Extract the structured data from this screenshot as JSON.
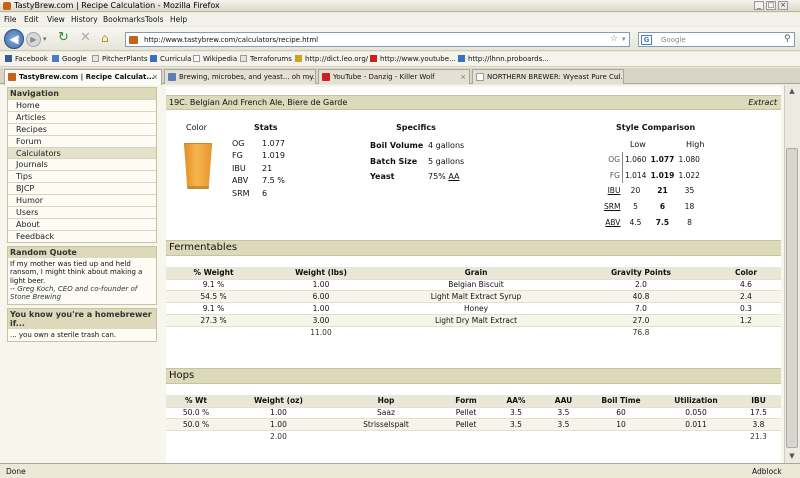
{
  "window": {
    "title": "TastyBrew.com | Recipe Calculation - Mozilla Firefox"
  },
  "menu": [
    "File",
    "Edit",
    "View",
    "History",
    "Bookmarks",
    "Tools",
    "Help"
  ],
  "nav": {
    "url": "http://www.tastybrew.com/calculators/recipe.html",
    "search_placeholder": "Google"
  },
  "bookmarks": [
    "Facebook",
    "Google",
    "PitcherPlants",
    "Curricula",
    "Wikipedia",
    "Terraforums",
    "http://dict.leo.org/",
    "http://www.youtube...",
    "http://lhnn.proboards..."
  ],
  "tabs": [
    "TastyBrew.com | Recipe Calculat...",
    "Brewing, microbes, and yeast... oh my...",
    "YouTube - Danzig - Killer Wolf",
    "NORTHERN BREWER: Wyeast Pure Cul..."
  ],
  "sidebar": {
    "nav_title": "Navigation",
    "items": [
      "Home",
      "Articles",
      "Recipes",
      "Forum",
      "Calculators",
      "Journals",
      "Tips",
      "BJCP",
      "Humor",
      "Users",
      "About",
      "Feedback"
    ],
    "quote_title": "Random Quote",
    "quote_text": "If my mother was tied up and held ransom, I might think about making a light beer.",
    "quote_author": "-- Greg Koch, CEO and co-founder of Stone Brewing",
    "hb_title": "You know you're a homebrewer if...",
    "hb_text": "... you own a sterile trash can."
  },
  "recipe": {
    "style": "19C. Belgian And French Ale, Biere de Garde",
    "type": "Extract",
    "headers": {
      "color": "Color",
      "stats": "Stats",
      "specifics": "Specifics",
      "style_comp": "Style Comparison",
      "low": "Low",
      "high": "High"
    },
    "stats": [
      {
        "k": "OG",
        "v": "1.077"
      },
      {
        "k": "FG",
        "v": "1.019"
      },
      {
        "k": "IBU",
        "v": "21"
      },
      {
        "k": "ABV",
        "v": "7.5 %"
      },
      {
        "k": "SRM",
        "v": "6"
      }
    ],
    "specifics": [
      {
        "k": "Boil Volume",
        "v": "4 gallons"
      },
      {
        "k": "Batch Size",
        "v": "5 gallons"
      },
      {
        "k": "Yeast",
        "v": "75%",
        "link": "AA"
      }
    ],
    "comparison": [
      {
        "k": "OG",
        "low": "1.060",
        "val": "1.077",
        "high": "1.080"
      },
      {
        "k": "FG",
        "low": "1.014",
        "val": "1.019",
        "high": "1.022"
      },
      {
        "k": "IBU",
        "low": "20",
        "val": "21",
        "high": "35"
      },
      {
        "k": "SRM",
        "low": "5",
        "val": "6",
        "high": "18"
      },
      {
        "k": "ABV",
        "low": "4.5",
        "val": "7.5",
        "high": "8"
      }
    ],
    "beer_color": "#f2a23a"
  },
  "fermentables": {
    "title": "Fermentables",
    "headers": [
      "% Weight",
      "Weight (lbs)",
      "Grain",
      "Gravity Points",
      "Color"
    ],
    "rows": [
      [
        "9.1 %",
        "1.00",
        "Belgian Biscuit",
        "2.0",
        "4.6"
      ],
      [
        "54.5 %",
        "6.00",
        "Light Malt Extract Syrup",
        "40.8",
        "2.4"
      ],
      [
        "9.1 %",
        "1.00",
        "Honey",
        "7.0",
        "0.3"
      ],
      [
        "27.3 %",
        "3.00",
        "Light Dry Malt Extract",
        "27.0",
        "1.2"
      ]
    ],
    "total": [
      "",
      "11.00",
      "",
      "76.8",
      ""
    ]
  },
  "hops": {
    "title": "Hops",
    "headers": [
      "% Wt",
      "Weight (oz)",
      "Hop",
      "Form",
      "AA%",
      "AAU",
      "Boil Time",
      "Utilization",
      "IBU"
    ],
    "rows": [
      [
        "50.0 %",
        "1.00",
        "Saaz",
        "Pellet",
        "3.5",
        "3.5",
        "60",
        "0.050",
        "17.5"
      ],
      [
        "50.0 %",
        "1.00",
        "Strisselspalt",
        "Pellet",
        "3.5",
        "3.5",
        "10",
        "0.011",
        "3.8"
      ]
    ],
    "total": [
      "",
      "2.00",
      "",
      "",
      "",
      "",
      "",
      "",
      "21.3"
    ]
  },
  "status": {
    "left": "Done",
    "right": "Adblock"
  }
}
